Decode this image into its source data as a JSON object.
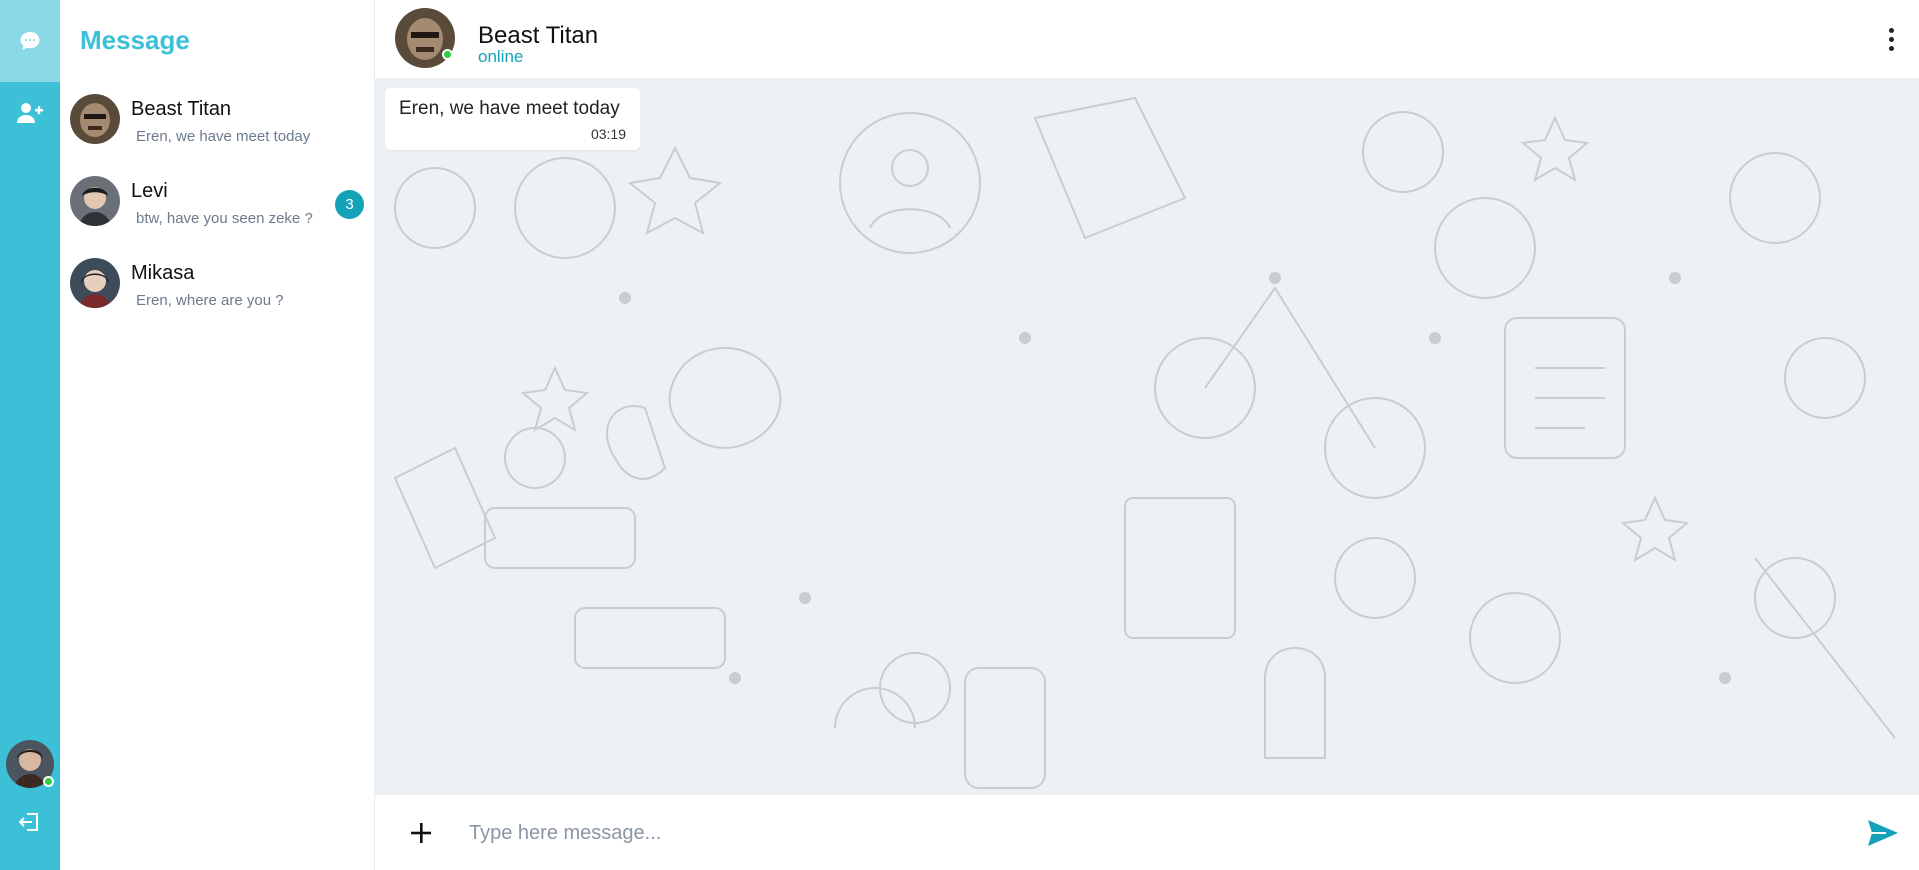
{
  "colors": {
    "accent": "#3cc0d8",
    "accent_light": "#8ad7e6",
    "badge": "#14a2b8",
    "online": "#2ecc40",
    "chat_background": "#eef1f4"
  },
  "rail": {
    "items": [
      {
        "icon": "chat-bubble-icon",
        "active": true
      },
      {
        "icon": "add-user-icon",
        "active": false
      }
    ],
    "user_avatar": "avatar",
    "logout_icon": "logout-icon"
  },
  "sidebar": {
    "title": "Message",
    "chats": [
      {
        "name": "Beast Titan",
        "preview": "Eren, we have meet today",
        "unread": ""
      },
      {
        "name": "Levi",
        "preview": "btw, have you seen zeke ?",
        "unread": "3"
      },
      {
        "name": "Mikasa",
        "preview": "Eren, where are you ?",
        "unread": ""
      }
    ]
  },
  "conversation": {
    "contact_name": "Beast Titan",
    "status": "online",
    "messages": [
      {
        "text": "Eren, we have meet today",
        "time": "03:19"
      }
    ]
  },
  "composer": {
    "placeholder": "Type here message...",
    "attach_icon": "plus-icon",
    "send_icon": "send-icon"
  }
}
